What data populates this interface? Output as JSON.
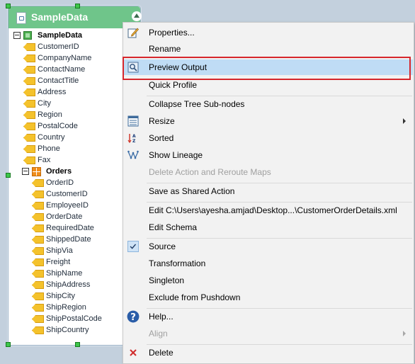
{
  "panel": {
    "title": "SampleData",
    "root": "SampleData",
    "fields": [
      "CustomerID",
      "CompanyName",
      "ContactName",
      "ContactTitle",
      "Address",
      "City",
      "Region",
      "PostalCode",
      "Country",
      "Phone",
      "Fax"
    ],
    "orders": {
      "label": "Orders",
      "fields": [
        "OrderID",
        "CustomerID",
        "EmployeeID",
        "OrderDate",
        "RequiredDate",
        "ShippedDate",
        "ShipVia",
        "Freight",
        "ShipName",
        "ShipAddress",
        "ShipCity",
        "ShipRegion",
        "ShipPostalCode",
        "ShipCountry"
      ]
    }
  },
  "menu": {
    "properties": "Properties...",
    "rename": "Rename",
    "preview_output": "Preview Output",
    "quick_profile": "Quick Profile",
    "collapse_tree": "Collapse Tree Sub-nodes",
    "resize": "Resize",
    "sorted": "Sorted",
    "show_lineage": "Show Lineage",
    "delete_action": "Delete Action and Reroute Maps",
    "save_shared": "Save as Shared Action",
    "edit_file": "Edit C:\\Users\\ayesha.amjad\\Desktop...\\CustomerOrderDetails.xml",
    "edit_schema": "Edit Schema",
    "source": "Source",
    "transformation": "Transformation",
    "singleton": "Singleton",
    "exclude_pushdown": "Exclude from Pushdown",
    "help": "Help...",
    "align": "Align",
    "delete": "Delete"
  },
  "colors": {
    "header": "#6fc58a",
    "highlight": "#bfdcf5",
    "highlight_frame": "#d6272d"
  }
}
